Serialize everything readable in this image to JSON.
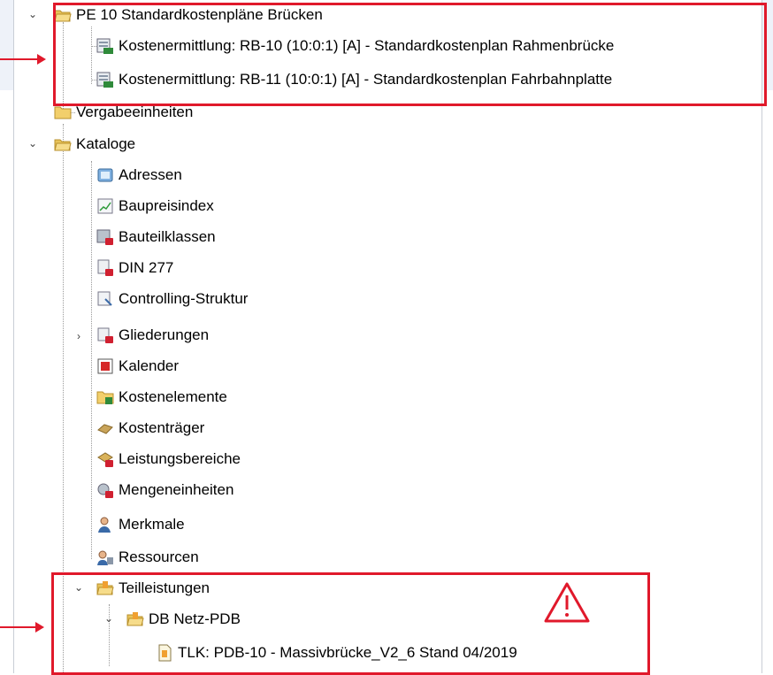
{
  "tree": {
    "root1": {
      "label": "PE 10 Standardkostenpläne Brücken"
    },
    "kosten": [
      {
        "label": "Kostenermittlung: RB-10 (10:0:1) [A]  - Standardkostenplan Rahmenbrücke"
      },
      {
        "label": "Kostenermittlung: RB-11 (10:0:1) [A]  - Standardkostenplan Fahrbahnplatte"
      }
    ],
    "vergabe": {
      "label": "Vergabeeinheiten"
    },
    "kataloge": {
      "label": "Kataloge",
      "items": [
        {
          "label": "Adressen",
          "icon": "address-book-icon"
        },
        {
          "label": "Baupreisindex",
          "icon": "chart-icon"
        },
        {
          "label": "Bauteilklassen",
          "icon": "locked-class-icon"
        },
        {
          "label": "DIN 277",
          "icon": "locked-din-icon"
        },
        {
          "label": "Controlling-Struktur",
          "icon": "controlling-icon"
        },
        {
          "label": "Gliederungen",
          "icon": "locked-structure-icon"
        },
        {
          "label": "Kalender",
          "icon": "calendar-icon"
        },
        {
          "label": "Kostenelemente",
          "icon": "cost-elements-icon"
        },
        {
          "label": "Kostenträger",
          "icon": "cost-carrier-icon"
        },
        {
          "label": "Leistungsbereiche",
          "icon": "locked-service-icon"
        },
        {
          "label": "Mengeneinheiten",
          "icon": "locked-units-icon"
        },
        {
          "label": "Merkmale",
          "icon": "person-icon"
        },
        {
          "label": "Ressourcen",
          "icon": "resources-icon"
        }
      ]
    },
    "teilleistungen": {
      "label": "Teilleistungen"
    },
    "dbnetz": {
      "label": "DB Netz-PDB"
    },
    "tlk": {
      "label": "TLK: PDB-10 - Massivbrücke_V2_6 Stand 04/2019"
    }
  },
  "colors": {
    "highlight": "#e0192b",
    "folder": "#f2cf6b"
  }
}
